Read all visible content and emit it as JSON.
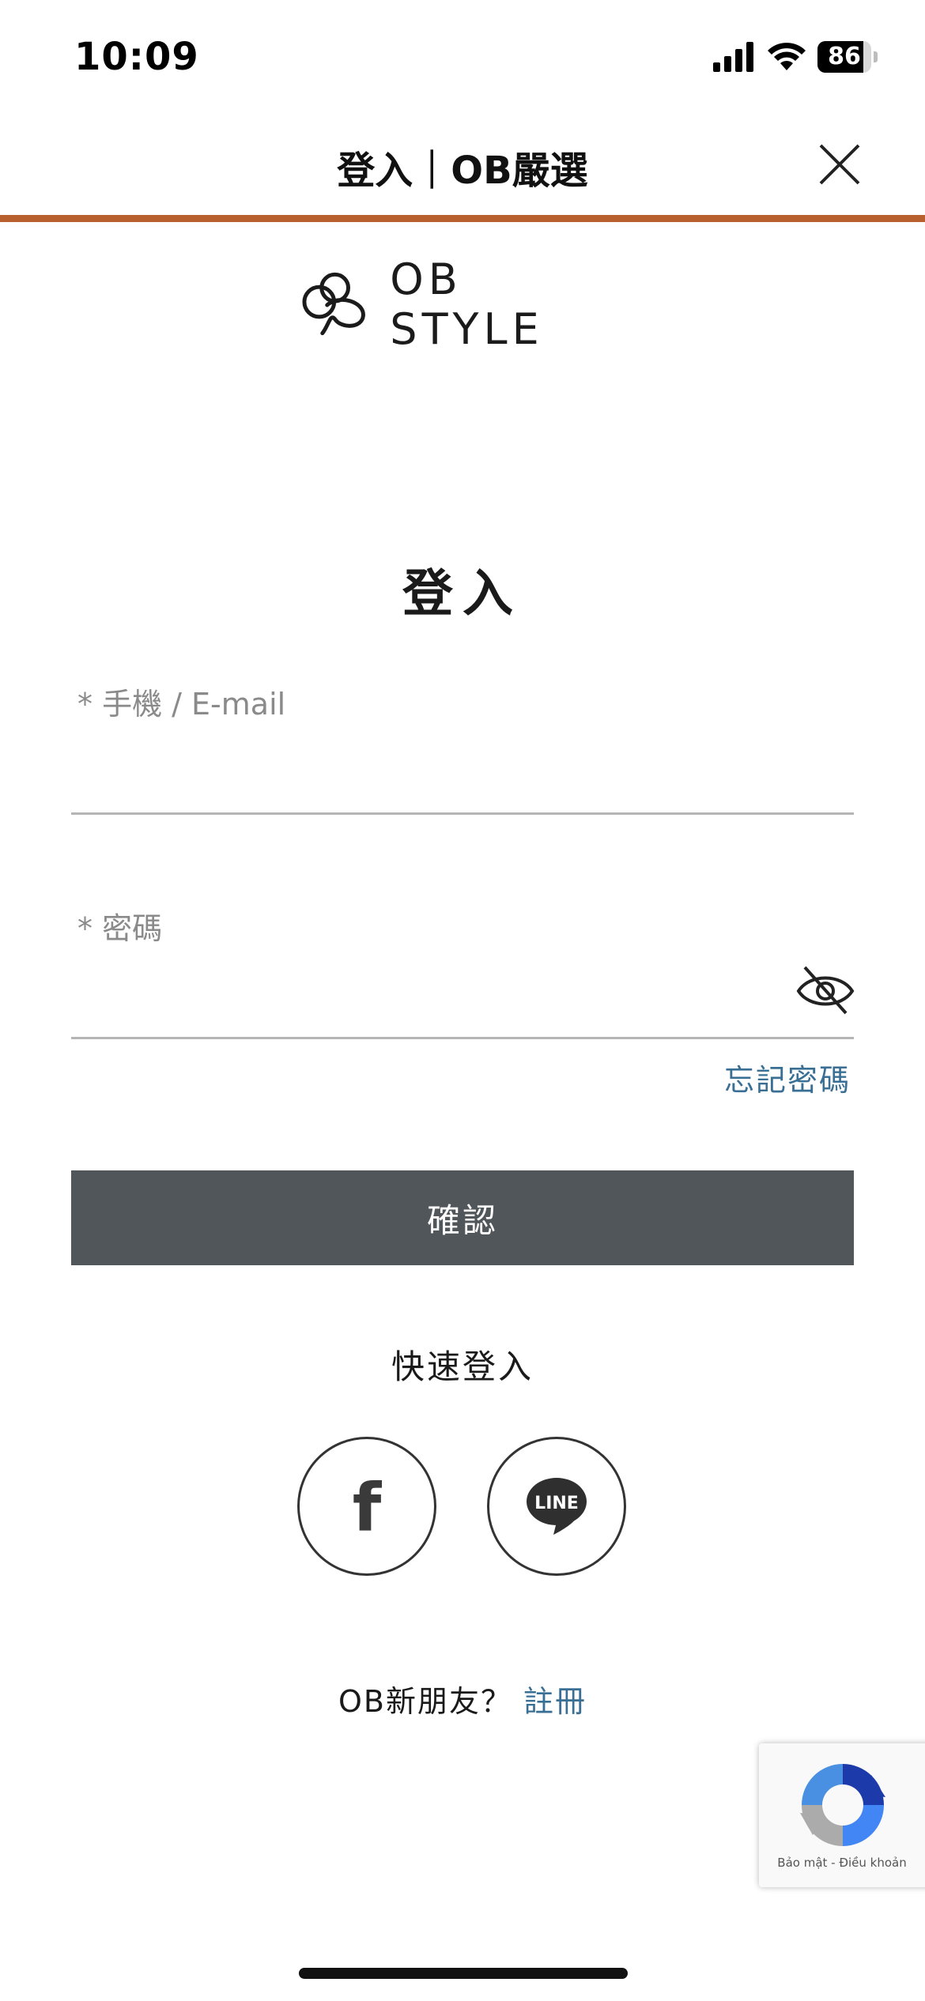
{
  "status_bar": {
    "time": "10:09",
    "battery_level": "86",
    "battery_percent": 86,
    "icons": [
      "signal-icon",
      "wifi-icon",
      "battery-icon"
    ]
  },
  "header": {
    "title": "登入｜OB嚴選",
    "close_icon": "close-icon",
    "accent_color": "#b8602e"
  },
  "brand": {
    "name": "OB STYLE",
    "logo_icon": "ob-style-logo-mark"
  },
  "login_form": {
    "heading": "登入",
    "account_label": "* 手機 / E-mail",
    "account_value": "",
    "password_label": "* 密碼",
    "password_value": "",
    "password_toggle_icon": "eye-off-icon",
    "forgot_password": "忘記密碼",
    "confirm_button": "確認",
    "confirm_button_color": "#51565b"
  },
  "quick_login": {
    "label": "快速登入",
    "facebook_glyph": "f",
    "line_glyph": "LINE",
    "icons": [
      "facebook-icon",
      "line-icon"
    ]
  },
  "register": {
    "prompt": "OB新朋友？",
    "link": "註冊",
    "link_color": "#3a6f95"
  },
  "recaptcha": {
    "terms": "Bảo mật - Điều khoản",
    "icon": "recaptcha-logo-icon"
  }
}
